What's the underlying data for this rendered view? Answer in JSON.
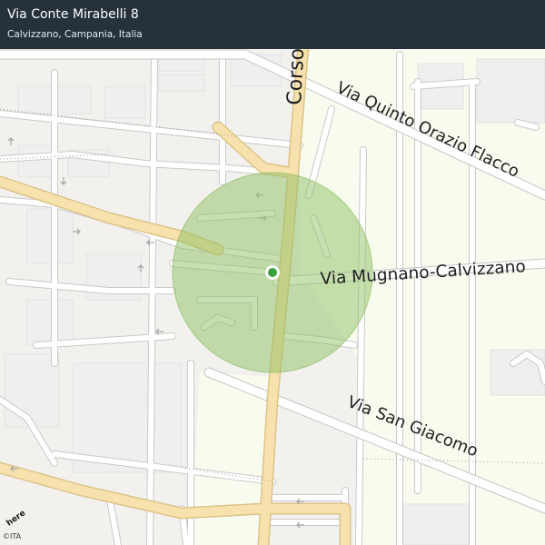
{
  "header": {
    "title": "Via Conte Mirabelli 8",
    "subtitle": "Calvizzano, Campania, Italia"
  },
  "map": {
    "road_labels": [
      "Corso Italia",
      "Via  Quinto  Orazio  Flacco",
      "Via  Mugnano-Calvizzano",
      "Via  San  Giacomo"
    ],
    "attribution": "©ITA",
    "logo_text": "here",
    "colors": {
      "background": "#f2f1ee",
      "green_area": "#f8fcef",
      "block": "#efefef",
      "street": "#ffffff",
      "street_casing": "#c9c9c9",
      "main_road": "#f7e2ad",
      "main_road_casing": "#dcc38a",
      "accuracy_circle": "#8fbf64",
      "location_dot": "#3aa23a"
    }
  }
}
